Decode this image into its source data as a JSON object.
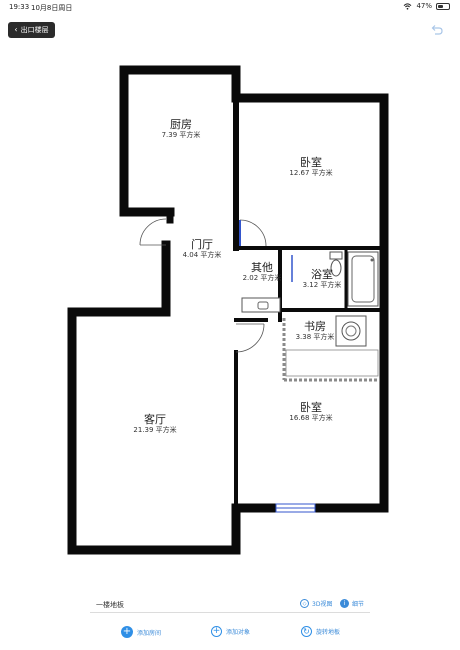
{
  "status_bar": {
    "time": "19:33",
    "date": "10月8日周日",
    "battery": "47%",
    "battery_level": 0.47
  },
  "header": {
    "back_label": "出口楼层"
  },
  "rooms": {
    "kitchen": {
      "name": "厨房",
      "area": "7.39 平方米"
    },
    "bedroom1": {
      "name": "卧室",
      "area": "12.67 平方米"
    },
    "hall": {
      "name": "门厅",
      "area": "4.04 平方米"
    },
    "other": {
      "name": "其他",
      "area": "2.02 平方米"
    },
    "bathroom": {
      "name": "浴室",
      "area": "3.12 平方米"
    },
    "study": {
      "name": "书房",
      "area": "3.38 平方米"
    },
    "living": {
      "name": "客厅",
      "area": "21.39 平方米"
    },
    "bedroom2": {
      "name": "卧室",
      "area": "16.68 平方米"
    }
  },
  "footer": {
    "floor_name": "一楼地板",
    "view_3d": "3D视图",
    "details": "细节",
    "add_room": "添加房间",
    "add_object": "添加对象",
    "rotate_floor": "旋转地板"
  },
  "colors": {
    "wall": "#0a0a0a",
    "accent": "#2f8fe6",
    "link": "#3b8bd9",
    "dashed_wall": "#8a8a8a",
    "window": "#3355cc"
  }
}
